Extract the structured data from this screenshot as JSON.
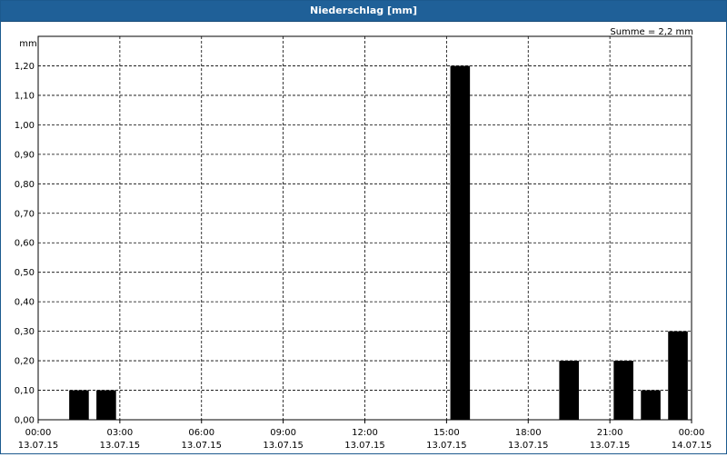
{
  "window": {
    "title": "Niederschlag [mm]"
  },
  "summary": "Summe = 2,2 mm",
  "colors": {
    "titlebar": "#1f6098",
    "bars": "#000000",
    "grid": "#000000"
  },
  "chart_data": {
    "type": "bar",
    "title": "Niederschlag [mm]",
    "ylabel": "mm",
    "ylim": [
      0,
      1.3
    ],
    "xlim": [
      "13.07.15 00:00",
      "14.07.15 00:00"
    ],
    "grid": true,
    "yticks": [
      "0,00",
      "0,10",
      "0,20",
      "0,30",
      "0,40",
      "0,50",
      "0,60",
      "0,70",
      "0,80",
      "0,90",
      "1,00",
      "1,10",
      "1,20"
    ],
    "xticks": [
      {
        "time": "00:00",
        "date": "13.07.15"
      },
      {
        "time": "03:00",
        "date": "13.07.15"
      },
      {
        "time": "06:00",
        "date": "13.07.15"
      },
      {
        "time": "09:00",
        "date": "13.07.15"
      },
      {
        "time": "12:00",
        "date": "13.07.15"
      },
      {
        "time": "15:00",
        "date": "13.07.15"
      },
      {
        "time": "18:00",
        "date": "13.07.15"
      },
      {
        "time": "21:00",
        "date": "13.07.15"
      },
      {
        "time": "00:00",
        "date": "14.07.15"
      }
    ],
    "bars": [
      {
        "start": "13.07.15 01:00",
        "end": "13.07.15 02:00",
        "value": 0.1
      },
      {
        "start": "13.07.15 02:00",
        "end": "13.07.15 03:00",
        "value": 0.1
      },
      {
        "start": "13.07.15 15:00",
        "end": "13.07.15 16:00",
        "value": 1.2
      },
      {
        "start": "13.07.15 19:00",
        "end": "13.07.15 20:00",
        "value": 0.2
      },
      {
        "start": "13.07.15 21:00",
        "end": "13.07.15 22:00",
        "value": 0.2
      },
      {
        "start": "13.07.15 22:00",
        "end": "13.07.15 23:00",
        "value": 0.1
      },
      {
        "start": "13.07.15 23:00",
        "end": "14.07.15 00:00",
        "value": 0.3
      }
    ]
  }
}
